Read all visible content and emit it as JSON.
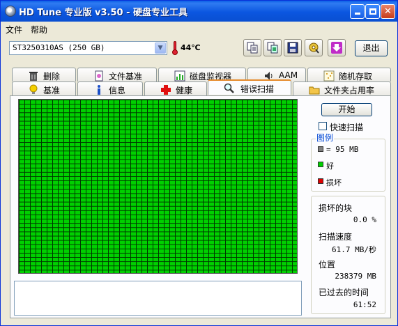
{
  "window": {
    "title": "HD Tune 专业版 v3.50 - 硬盘专业工具"
  },
  "menu": {
    "items": [
      "文件",
      "帮助"
    ]
  },
  "toolbar": {
    "drive": "ST3250310AS (250 GB)",
    "temperature": "44℃",
    "buttons": [
      "copy-info",
      "copy-screen",
      "save",
      "options",
      "download"
    ],
    "exit_label": "退出"
  },
  "tabs": {
    "row_top": [
      "删除",
      "文件基准",
      "磁盘监视器",
      "AAM",
      "随机存取"
    ],
    "row_bottom": [
      "基准",
      "信息",
      "健康",
      "错误扫描",
      "文件夹占用率"
    ],
    "active": "错误扫描"
  },
  "scan": {
    "start_label": "开始",
    "quick_scan_label": "快速扫描",
    "quick_scan_checked": false,
    "block_state": "all-good",
    "legend": {
      "title": "图例",
      "block_size": "= 95 MB",
      "good": "好",
      "bad": "损坏"
    },
    "stats": {
      "damaged_label": "损坏的块",
      "damaged_value": "0.0 %",
      "speed_label": "扫描速度",
      "speed_value": "61.7 MB/秒",
      "position_label": "位置",
      "position_value": "238379 MB",
      "elapsed_label": "已过去的时间",
      "elapsed_value": "61:52"
    }
  },
  "colors": {
    "good": "#00d000",
    "bad": "#e00000",
    "block": "#808080",
    "accent": "#0046d5"
  }
}
